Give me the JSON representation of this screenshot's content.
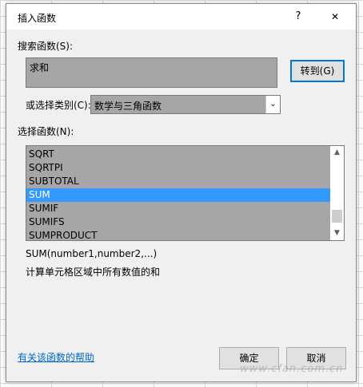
{
  "dialog": {
    "title": "插入函数",
    "help_glyph": "?",
    "close_glyph": "✕"
  },
  "search": {
    "label": "搜索函数(S):",
    "value": "求和",
    "go_label": "转到(G)"
  },
  "category": {
    "label": "或选择类别(C):",
    "value": "数学与三角函数"
  },
  "functions": {
    "label": "选择函数(N):",
    "items": [
      "SQRT",
      "SQRTPI",
      "SUBTOTAL",
      "SUM",
      "SUMIF",
      "SUMIFS",
      "SUMPRODUCT"
    ],
    "selected": "SUM"
  },
  "details": {
    "syntax": "SUM(number1,number2,...)",
    "description": "计算单元格区域中所有数值的和"
  },
  "footer": {
    "help_link": "有关该函数的帮助",
    "ok_label": "确定",
    "cancel_label": "取消"
  },
  "watermark": "www.cfan.com.cn",
  "colors": {
    "selection": "#3399ff",
    "link": "#0066cc",
    "focus_border": "#0078d7"
  }
}
